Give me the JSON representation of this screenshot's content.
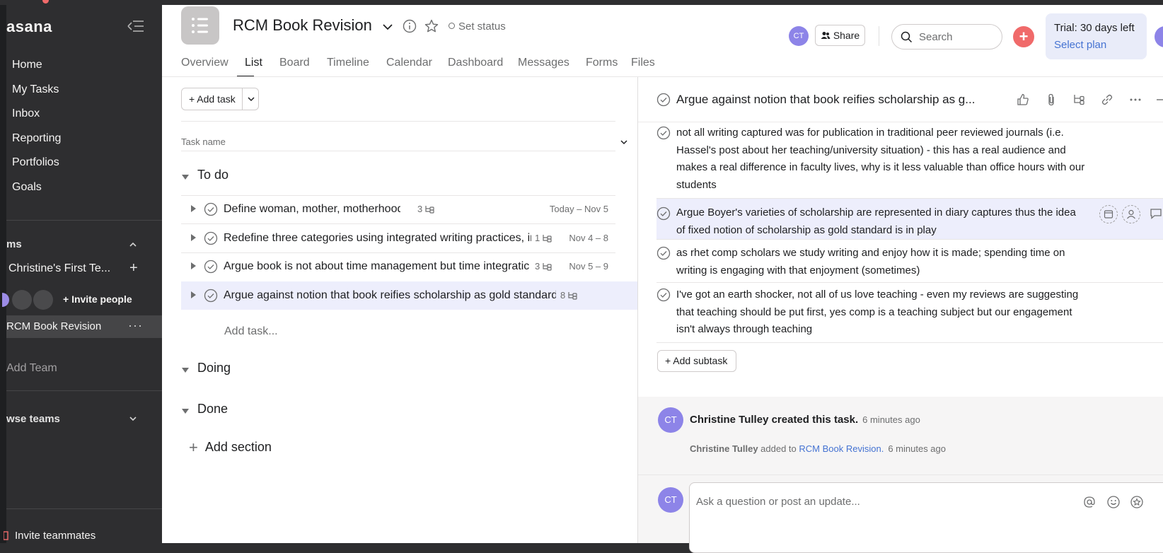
{
  "sidebar": {
    "logo": "asana",
    "nav": [
      "Home",
      "My Tasks",
      "Inbox",
      "Reporting",
      "Portfolios",
      "Goals"
    ],
    "teams_label": "ms",
    "team_name": "Christine's First Te...",
    "invite_people": "+ Invite people",
    "active_project": "RCM Book Revision",
    "add_team": "Add Team",
    "browse_teams": "wse teams",
    "invite_teammates": "Invite teammates"
  },
  "header": {
    "project_title": "RCM Book Revision",
    "set_status": "Set status",
    "avatar_initials": "CT",
    "share": "Share",
    "search_placeholder": "Search",
    "trial_line": "Trial: 30 days left",
    "select_plan": "Select plan",
    "tabs": [
      "Overview",
      "List",
      "Board",
      "Timeline",
      "Calendar",
      "Dashboard",
      "Messages",
      "Forms",
      "Files"
    ],
    "active_tab": "List"
  },
  "list": {
    "add_task": "Add task",
    "column_header": "Task name",
    "sections": {
      "todo": "To do",
      "doing": "Doing",
      "done": "Done"
    },
    "tasks": [
      {
        "name": "Define woman, mother, motherhood",
        "subtasks": "3",
        "due": "Today – Nov 5"
      },
      {
        "name": "Redefine three categories using integrated writing practices, ir",
        "subtasks": "1",
        "due": "Nov 4 – 8"
      },
      {
        "name": "Argue book is not about time management but time integratic",
        "subtasks": "3",
        "due": "Nov 5 – 9"
      },
      {
        "name": "Argue against notion that book reifies scholarship as gold standard",
        "subtasks": "8",
        "due": ""
      }
    ],
    "add_task_inline": "Add task...",
    "add_section": "Add section"
  },
  "detail": {
    "title": "Argue against notion that book reifies scholarship as g...",
    "subtasks": [
      "not all writing captured was for publication in traditional peer reviewed journals (i.e. Hassel's post about her teaching/university situation) - this has a real audience and makes a real difference in faculty lives, why is it less valuable than office hours with our students",
      "Argue Boyer's varieties of scholarship are represented in diary captures thus the idea of fixed notion of scholarship as gold standard is in play",
      "as rhet comp scholars we study writing and enjoy how it is made; spending time on writing is engaging with that enjoyment (sometimes)",
      "I've got an earth shocker, not all of us love teaching - even my reviews are suggesting that teaching should be put first, yes comp is a teaching subject but our engagement isn't always through teaching"
    ],
    "add_subtask": "Add subtask",
    "activity": {
      "created": "Christine Tulley created this task.",
      "created_time": "6 minutes ago",
      "added_who": "Christine Tulley",
      "added_mid": " added to ",
      "added_project": "RCM Book Revision.",
      "added_time": "6 minutes ago"
    },
    "comment_placeholder": "Ask a question or post an update..."
  },
  "colors": {
    "sidebar_bg": "#2e2e30",
    "accent_red": "#f06a6a",
    "avatar_purple": "#8d84e8",
    "link_blue": "#4573d2",
    "selected_row": "#edeefc"
  }
}
